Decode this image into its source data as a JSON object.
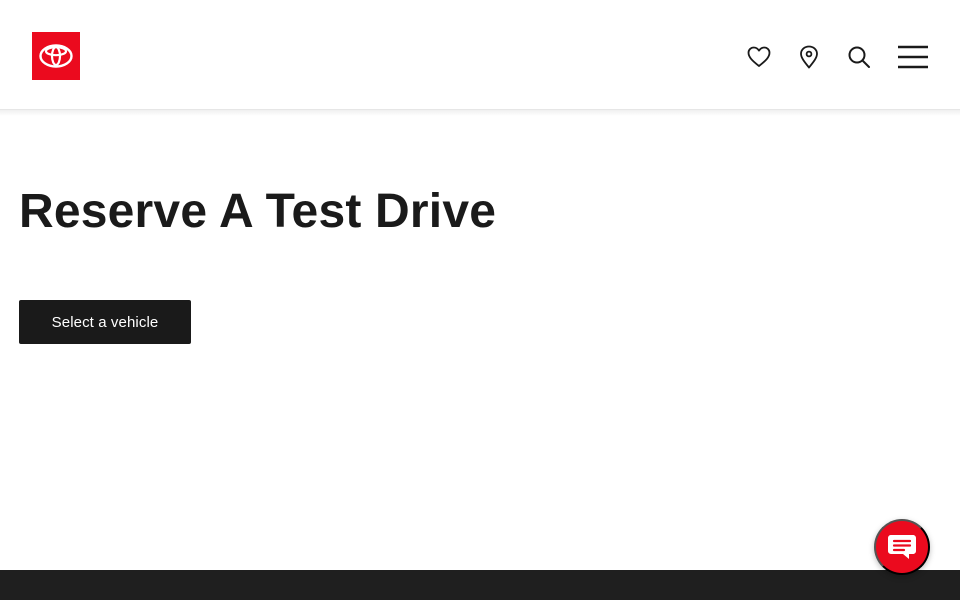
{
  "header": {
    "logo_icon": "toyota-logo-icon",
    "brand_color": "#eb0a1e",
    "icons": [
      "heart-icon",
      "location-pin-icon",
      "search-icon",
      "hamburger-menu-icon"
    ]
  },
  "main": {
    "title": "Reserve A Test Drive",
    "cta_label": "Select a vehicle"
  },
  "chat": {
    "icon": "chat-bubble-icon",
    "color": "#eb0a1e"
  },
  "footer": {
    "color": "#1f1f1f"
  }
}
